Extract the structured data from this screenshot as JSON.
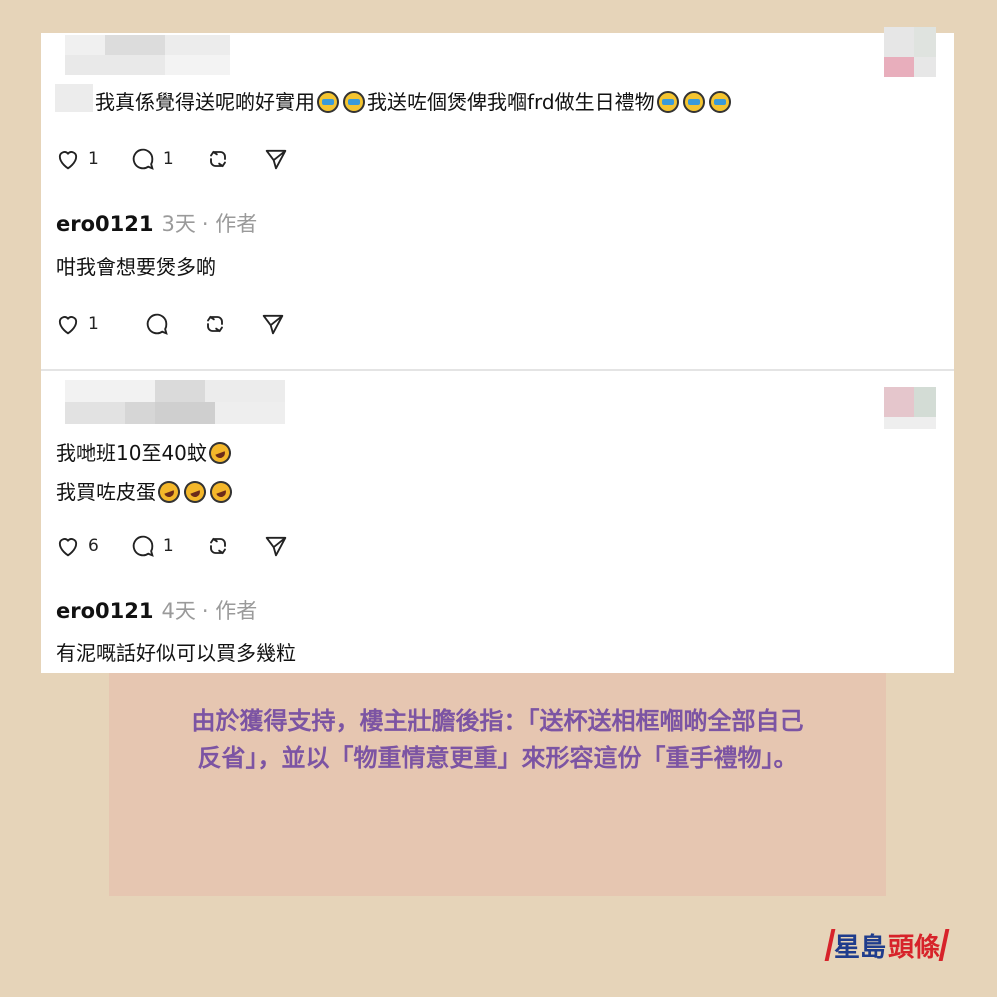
{
  "comments": [
    {
      "text_line1": "我真係覺得送呢啲好實用",
      "text_mid": "我送咗個煲俾我嗰frd做生日禮物",
      "likes": "1",
      "replies": "1"
    },
    {
      "username": "ero0121",
      "time": "3天",
      "role": "· 作者",
      "text": "咁我會想要煲多啲",
      "likes": "1"
    },
    {
      "text_line1": "我哋班10至40蚊",
      "text_line2": "我買咗皮蛋",
      "likes": "6",
      "replies": "1"
    },
    {
      "username": "ero0121",
      "time": "4天",
      "role": "· 作者",
      "text": "有泥嘅話好似可以買多幾粒"
    }
  ],
  "caption": "由於獲得支持，樓主壯膽後指：「送杯送相框嗰啲全部自己反省」，並以「物重情意更重」來形容這份「重手禮物」。",
  "logo": {
    "left": "星島",
    "right": "頭條"
  },
  "icons": [
    "heart-icon",
    "comment-icon",
    "repost-icon",
    "share-icon",
    "crying-emoji",
    "laughing-emoji"
  ],
  "colors": {
    "background": "#e6d4b9",
    "caption_bg": "#e6c6b1",
    "caption_text": "#7c54a3",
    "logo_blue": "#1f3c8c",
    "logo_red": "#d7232a"
  }
}
